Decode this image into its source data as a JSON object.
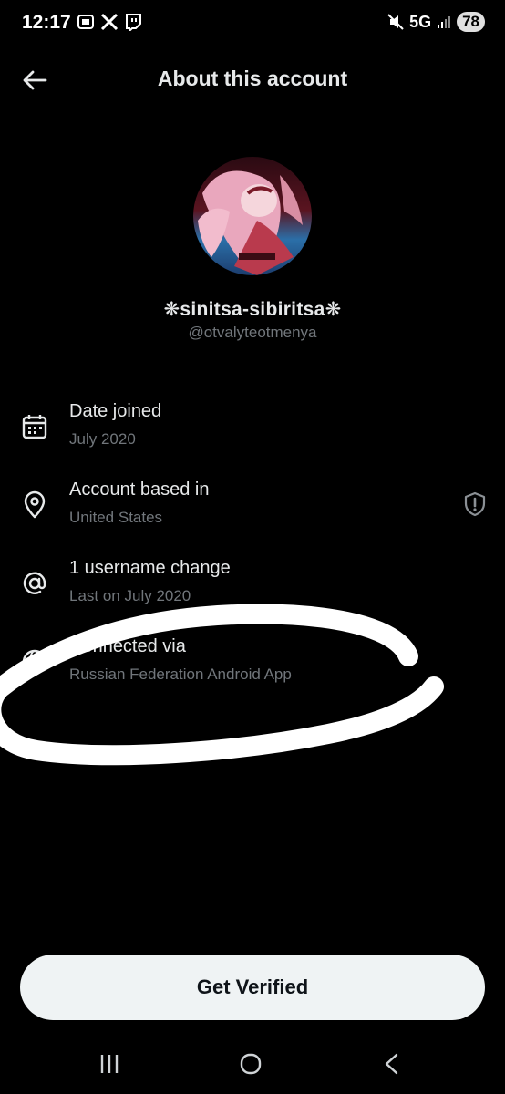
{
  "status_bar": {
    "time": "12:17",
    "network": "5G",
    "battery": "78"
  },
  "header": {
    "title": "About this account",
    "back_icon": "arrow-left-icon"
  },
  "profile": {
    "display_name": "❋sinitsa-sibiritsa❋",
    "handle": "@otvalyteotmenya"
  },
  "info_rows": [
    {
      "icon": "calendar-icon",
      "title": "Date joined",
      "subtitle": "July 2020"
    },
    {
      "icon": "location-pin-icon",
      "title": "Account based in",
      "subtitle": "United States"
    },
    {
      "icon": "at-sign-icon",
      "title": "1 username change",
      "subtitle": "Last on July 2020"
    },
    {
      "icon": "globe-icon",
      "title": "Connected via",
      "subtitle": "Russian Federation Android App"
    }
  ],
  "verify_button": {
    "label": "Get Verified"
  },
  "colors": {
    "background": "#000000",
    "primary_text": "#e7e9ea",
    "secondary_text": "#71767b",
    "button_bg": "#eff3f4"
  }
}
